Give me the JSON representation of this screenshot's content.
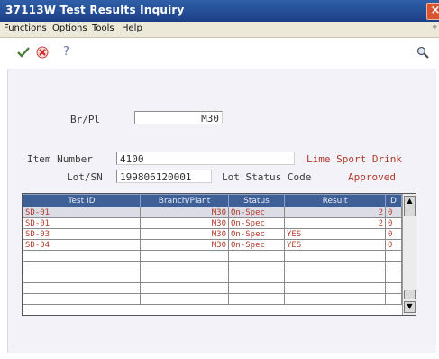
{
  "window": {
    "title": "37113W  Test Results Inquiry",
    "close_glyph": "×"
  },
  "menu": [
    "Functions",
    "Options",
    "Tools",
    "Help"
  ],
  "toolbar": {
    "ok_icon": "check-icon",
    "cancel_icon": "cancel-x-icon",
    "help_icon": "help-question-icon",
    "find_icon": "magnifier-icon",
    "help_glyph": "?"
  },
  "header": {
    "branch_label": "Br/Pl",
    "branch_value": "M30",
    "item_label": "Item Number",
    "item_value": "4100",
    "item_desc": "Lime Sport Drink",
    "lot_label": "Lot/SN",
    "lot_value": "199806120001",
    "lot_status_label": "Lot Status Code",
    "lot_status_value": "Approved"
  },
  "grid": {
    "columns": [
      "Test ID",
      "Branch/Plant",
      "Status",
      "Result",
      "D"
    ],
    "rows": [
      [
        "SD-01",
        "M30",
        "On-Spec",
        "2",
        "0"
      ],
      [
        "SD-01",
        "M30",
        "On-Spec",
        "2",
        "0"
      ],
      [
        "SD-03",
        "M30",
        "On-Spec",
        "YES",
        "0"
      ],
      [
        "SD-04",
        "M30",
        "On-Spec",
        "YES",
        "0"
      ],
      [
        "",
        "",
        "",
        "",
        ""
      ],
      [
        "",
        "",
        "",
        "",
        ""
      ],
      [
        "",
        "",
        "",
        "",
        ""
      ],
      [
        "",
        "",
        "",
        "",
        ""
      ],
      [
        "",
        "",
        "",
        "",
        ""
      ]
    ]
  },
  "colors": {
    "title_bar": "#2f5fa8",
    "grid_header": "#3f5f97",
    "value_red": "#b23a2a",
    "panel_bg": "#f2f2f8"
  }
}
